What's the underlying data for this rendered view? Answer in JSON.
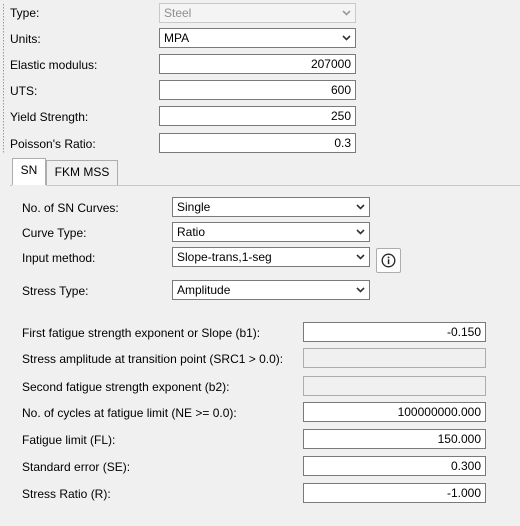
{
  "material": {
    "type_label": "Type:",
    "type_value": "Steel",
    "units_label": "Units:",
    "units_value": "MPA",
    "elastic_label": "Elastic modulus:",
    "elastic_value": "207000",
    "uts_label": "UTS:",
    "uts_value": "600",
    "yield_label": "Yield Strength:",
    "yield_value": "250",
    "poisson_label": "Poisson's Ratio:",
    "poisson_value": "0.3"
  },
  "tabs": [
    {
      "label": "SN"
    },
    {
      "label": "FKM MSS"
    }
  ],
  "sn": {
    "curves_label": "No. of SN Curves:",
    "curves_value": "Single",
    "curve_type_label": "Curve Type:",
    "curve_type_value": "Ratio",
    "input_method_label": "Input method:",
    "input_method_value": "Slope-trans,1-seg",
    "stress_type_label": "Stress Type:",
    "stress_type_value": "Amplitude"
  },
  "params": {
    "b1_label": "First fatigue strength exponent or Slope (b1):",
    "b1_value": "-0.150",
    "src1_label": "Stress amplitude at transition point (SRC1 > 0.0):",
    "src1_value": "",
    "b2_label": "Second fatigue strength exponent (b2):",
    "b2_value": "",
    "ne_label": "No. of cycles at fatigue limit (NE >= 0.0):",
    "ne_value": "100000000.000",
    "fl_label": "Fatigue limit (FL):",
    "fl_value": "150.000",
    "se_label": "Standard error (SE):",
    "se_value": "0.300",
    "r_label": "Stress Ratio (R):",
    "r_value": "-1.000"
  },
  "icons": {
    "dropdown": "chevron-down-icon",
    "info": "info-icon"
  }
}
